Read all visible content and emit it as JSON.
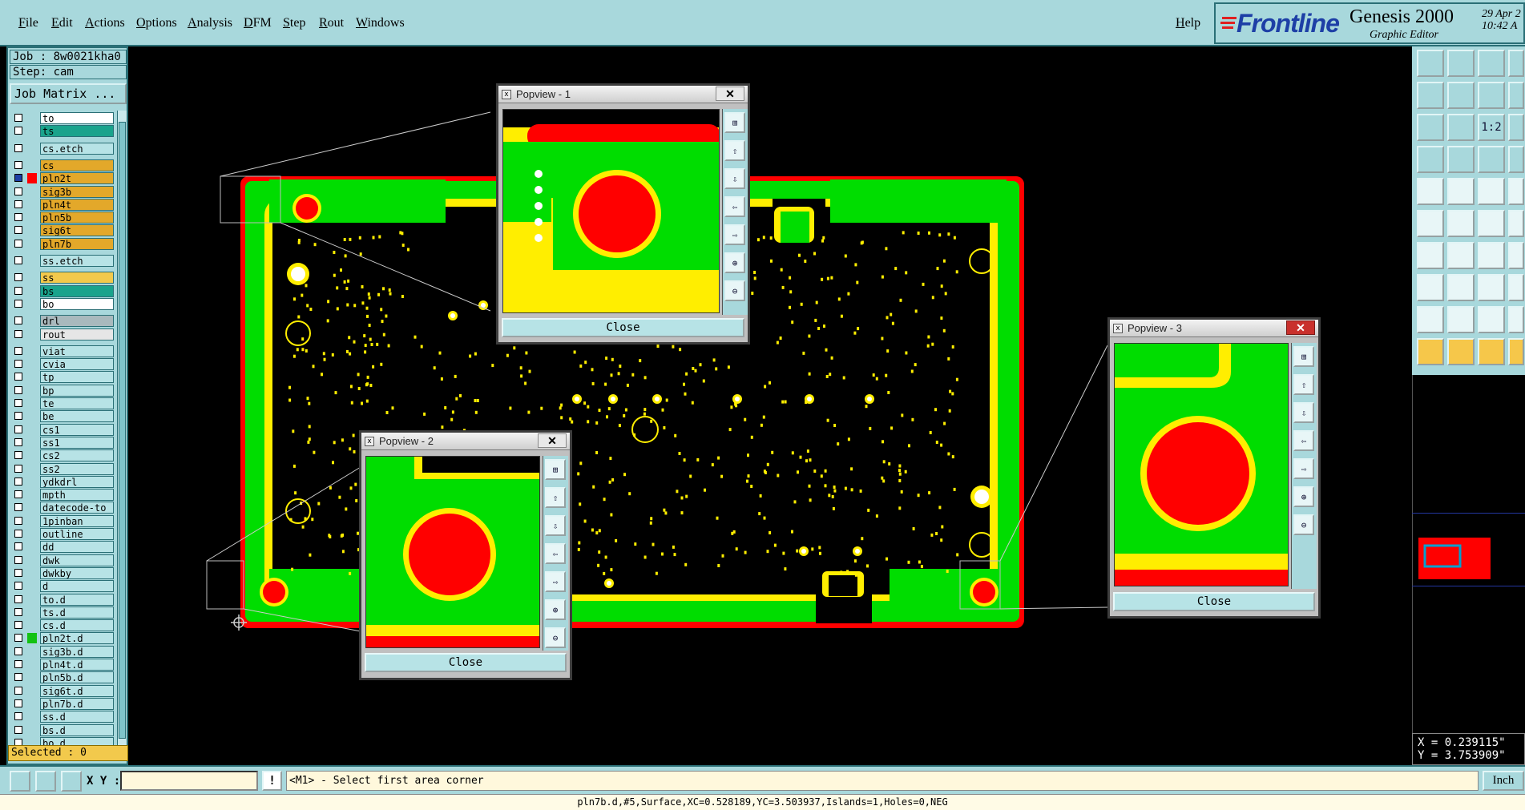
{
  "menu": {
    "items": [
      "File",
      "Edit",
      "Actions",
      "Options",
      "Analysis",
      "DFM",
      "Step",
      "Rout",
      "Windows"
    ],
    "help": "Help"
  },
  "brand": {
    "logo": "Frontline",
    "product": "Genesis 2000",
    "subtitle": "Graphic Editor",
    "date": "29 Apr 2",
    "time": "10:42 A"
  },
  "job": {
    "job_line": "Job : 8w0021kha0",
    "step_line": "Step: cam",
    "matrix_button": "Job Matrix ..."
  },
  "layers": [
    {
      "name": "to",
      "color": "#ffffff"
    },
    {
      "name": "ts",
      "color": "#1aa38c"
    },
    {
      "name": "cs.etch",
      "color": "#b7e3e6",
      "gap": true
    },
    {
      "name": "cs",
      "color": "#e3a82a",
      "gap": true
    },
    {
      "name": "pln2t",
      "color": "#e3a82a",
      "mark": "#ff0000",
      "checked": true
    },
    {
      "name": "sig3b",
      "color": "#e3a82a"
    },
    {
      "name": "pln4t",
      "color": "#e3a82a"
    },
    {
      "name": "pln5b",
      "color": "#e3a82a"
    },
    {
      "name": "sig6t",
      "color": "#e3a82a"
    },
    {
      "name": "pln7b",
      "color": "#e3a82a"
    },
    {
      "name": "ss.etch",
      "color": "#b7e3e6",
      "gap": true
    },
    {
      "name": "ss",
      "color": "#f2c94c",
      "gap": true
    },
    {
      "name": "bs",
      "color": "#1aa38c"
    },
    {
      "name": "bo",
      "color": "#ffffff"
    },
    {
      "name": "drl",
      "color": "#a9b9bd",
      "gap": true
    },
    {
      "name": "rout",
      "color": "#e6e6e6"
    },
    {
      "name": "viat",
      "color": "#b7e3e6",
      "gap": true
    },
    {
      "name": "cvia",
      "color": "#b7e3e6"
    },
    {
      "name": "tp",
      "color": "#b7e3e6"
    },
    {
      "name": "bp",
      "color": "#b7e3e6"
    },
    {
      "name": "te",
      "color": "#b7e3e6"
    },
    {
      "name": "be",
      "color": "#b7e3e6"
    },
    {
      "name": "cs1",
      "color": "#b7e3e6"
    },
    {
      "name": "ss1",
      "color": "#b7e3e6"
    },
    {
      "name": "cs2",
      "color": "#b7e3e6"
    },
    {
      "name": "ss2",
      "color": "#b7e3e6"
    },
    {
      "name": "ydkdrl",
      "color": "#b7e3e6"
    },
    {
      "name": "mpth",
      "color": "#b7e3e6"
    },
    {
      "name": "datecode-to",
      "color": "#b7e3e6"
    },
    {
      "name": "1pinban",
      "color": "#b7e3e6"
    },
    {
      "name": "outline",
      "color": "#b7e3e6"
    },
    {
      "name": "dd",
      "color": "#b7e3e6"
    },
    {
      "name": "dwk",
      "color": "#b7e3e6"
    },
    {
      "name": "dwkby",
      "color": "#b7e3e6"
    },
    {
      "name": "d",
      "color": "#b7e3e6"
    },
    {
      "name": "to.d",
      "color": "#b7e3e6"
    },
    {
      "name": "ts.d",
      "color": "#b7e3e6"
    },
    {
      "name": "cs.d",
      "color": "#b7e3e6"
    },
    {
      "name": "pln2t.d",
      "color": "#b7e3e6",
      "mark": "#13c213"
    },
    {
      "name": "sig3b.d",
      "color": "#b7e3e6"
    },
    {
      "name": "pln4t.d",
      "color": "#b7e3e6"
    },
    {
      "name": "pln5b.d",
      "color": "#b7e3e6"
    },
    {
      "name": "sig6t.d",
      "color": "#b7e3e6"
    },
    {
      "name": "pln7b.d",
      "color": "#b7e3e6"
    },
    {
      "name": "ss.d",
      "color": "#b7e3e6"
    },
    {
      "name": "bs.d",
      "color": "#b7e3e6"
    },
    {
      "name": "bo.d",
      "color": "#b7e3e6"
    }
  ],
  "selected": "Selected : 0",
  "popviews": [
    {
      "title": "Popview - 1",
      "close_label": "Close"
    },
    {
      "title": "Popview - 2",
      "close_label": "Close"
    },
    {
      "title": "Popview - 3",
      "close_label": "Close"
    }
  ],
  "popview_tool_icons": [
    "fit-icon",
    "pan-up-icon",
    "pan-down-icon",
    "pan-left-icon",
    "pan-right-icon",
    "zoom-in-icon",
    "zoom-out-icon"
  ],
  "coordinates": {
    "x": "X = 0.239115\"",
    "y": "Y = 3.753909\""
  },
  "command": {
    "xy_label": "X Y :",
    "xy_value": "",
    "exclaim": "!",
    "prompt": "<M1> - Select first area corner",
    "unit": "Inch"
  },
  "status": "pln7b.d,#5,Surface,XC=0.528189,YC=3.503937,Islands=1,Holes=0,NEG",
  "right_tool_labels": [
    "1:2"
  ],
  "colors": {
    "panel": "#a8d8dc",
    "board_green": "#00dd00",
    "board_yellow": "#ffee00",
    "board_red": "#ff0000",
    "background": "#000000"
  }
}
